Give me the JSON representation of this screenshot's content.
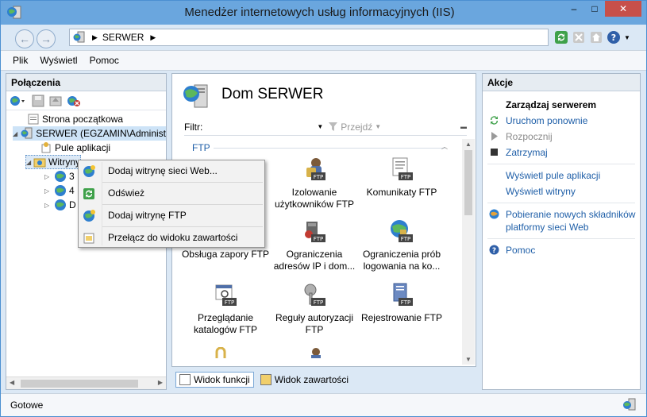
{
  "window": {
    "title": "Menedżer internetowych usług informacyjnych (IIS)",
    "controls": {
      "minimize": "–",
      "maximize": "□",
      "close": "✕"
    }
  },
  "address": {
    "crumbs": [
      "SERWER"
    ],
    "separator": "▶"
  },
  "menu": [
    "Plik",
    "Wyświetl",
    "Pomoc"
  ],
  "connections": {
    "header": "Połączenia",
    "tree": [
      {
        "label": "Strona początkowa"
      },
      {
        "label": "SERWER (EGZAMIN\\Administ"
      },
      {
        "label": "Pule aplikacji"
      },
      {
        "label": "Witryny"
      },
      {
        "label": "3"
      },
      {
        "label": "4"
      },
      {
        "label": "D"
      }
    ]
  },
  "center": {
    "title": "Dom SERWER",
    "filter_label": "Filtr:",
    "goto_label": "Przejdź",
    "group": "FTP",
    "features": [
      {
        "label": "Izolowanie użytkowników FTP"
      },
      {
        "label": "Komunikaty FTP"
      },
      {
        "label": "Obsługa zapory FTP"
      },
      {
        "label": "Ograniczenia adresów IP i dom..."
      },
      {
        "label": "Ograniczenia prób logowania na ko..."
      },
      {
        "label": "Przeglądanie katalogów FTP"
      },
      {
        "label": "Reguły autoryzacji FTP"
      },
      {
        "label": "Rejestrowanie FTP"
      }
    ],
    "tabs": [
      "Widok funkcji",
      "Widok zawartości"
    ]
  },
  "actions": {
    "header": "Akcje",
    "group_title": "Zarządzaj serwerem",
    "items": [
      {
        "label": "Uruchom ponownie",
        "enabled": true
      },
      {
        "label": "Rozpocznij",
        "enabled": false
      },
      {
        "label": "Zatrzymaj",
        "enabled": true
      },
      {
        "label": "Wyświetl pule aplikacji",
        "enabled": true
      },
      {
        "label": "Wyświetl witryny",
        "enabled": true
      },
      {
        "label": "Pobieranie nowych składników platformy sieci Web",
        "enabled": true
      },
      {
        "label": "Pomoc",
        "enabled": true
      }
    ]
  },
  "context_menu": {
    "items": [
      {
        "label": "Dodaj witrynę sieci Web..."
      },
      {
        "label": "Odśwież"
      },
      {
        "label": "Dodaj witrynę FTP"
      },
      {
        "label": "Przełącz do widoku zawartości"
      }
    ]
  },
  "status": {
    "text": "Gotowe"
  },
  "colors": {
    "accent": "#1f5fa8",
    "titlebar": "#6aa6de",
    "close": "#c7504a"
  }
}
